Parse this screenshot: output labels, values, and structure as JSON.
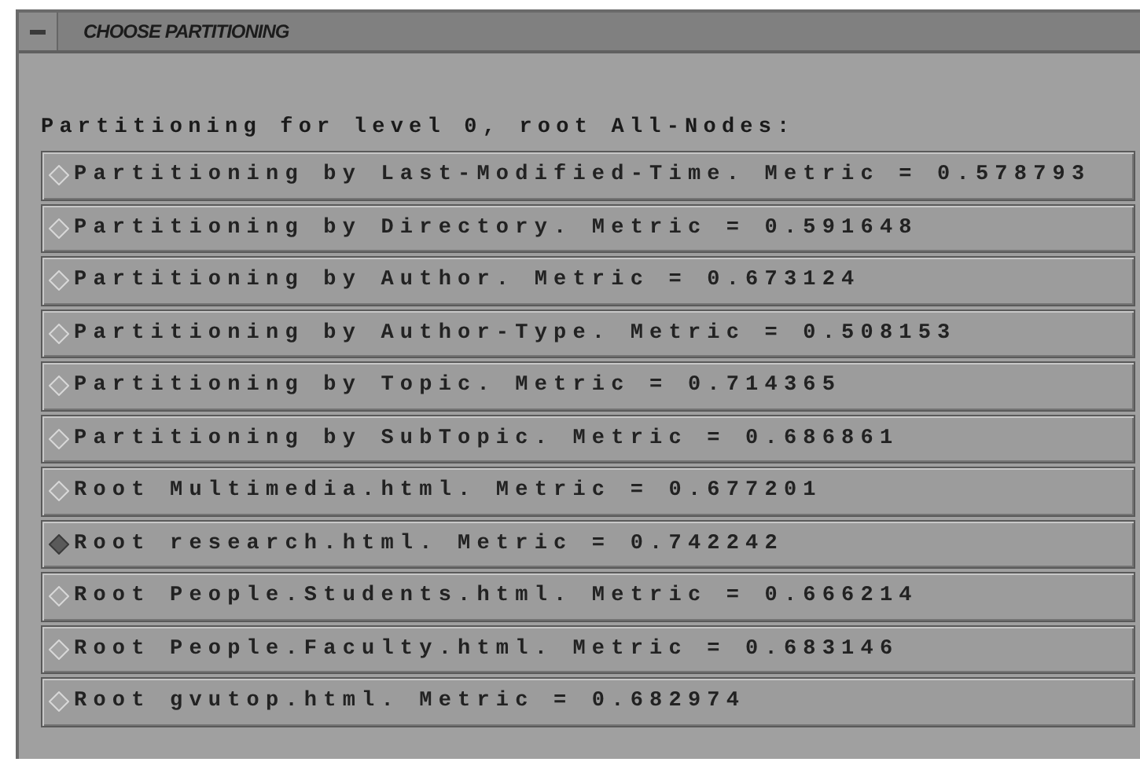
{
  "window": {
    "title": "CHOOSE PARTITIONING"
  },
  "heading": "Partitioning for level 0, root All-Nodes:",
  "options": [
    {
      "label": "Partitioning by Last-Modified-Time. Metric = 0.578793",
      "selected": false
    },
    {
      "label": "Partitioning by Directory. Metric = 0.591648",
      "selected": false
    },
    {
      "label": "Partitioning by Author. Metric = 0.673124",
      "selected": false
    },
    {
      "label": "Partitioning by Author-Type. Metric = 0.508153",
      "selected": false
    },
    {
      "label": "Partitioning by Topic. Metric = 0.714365",
      "selected": false
    },
    {
      "label": "Partitioning by SubTopic. Metric = 0.686861",
      "selected": false
    },
    {
      "label": "Root Multimedia.html. Metric = 0.677201",
      "selected": false
    },
    {
      "label": "Root research.html. Metric = 0.742242",
      "selected": true
    },
    {
      "label": "Root People.Students.html. Metric = 0.666214",
      "selected": false
    },
    {
      "label": "Root People.Faculty.html. Metric = 0.683146",
      "selected": false
    },
    {
      "label": "Root gvutop.html. Metric = 0.682974",
      "selected": false
    }
  ]
}
